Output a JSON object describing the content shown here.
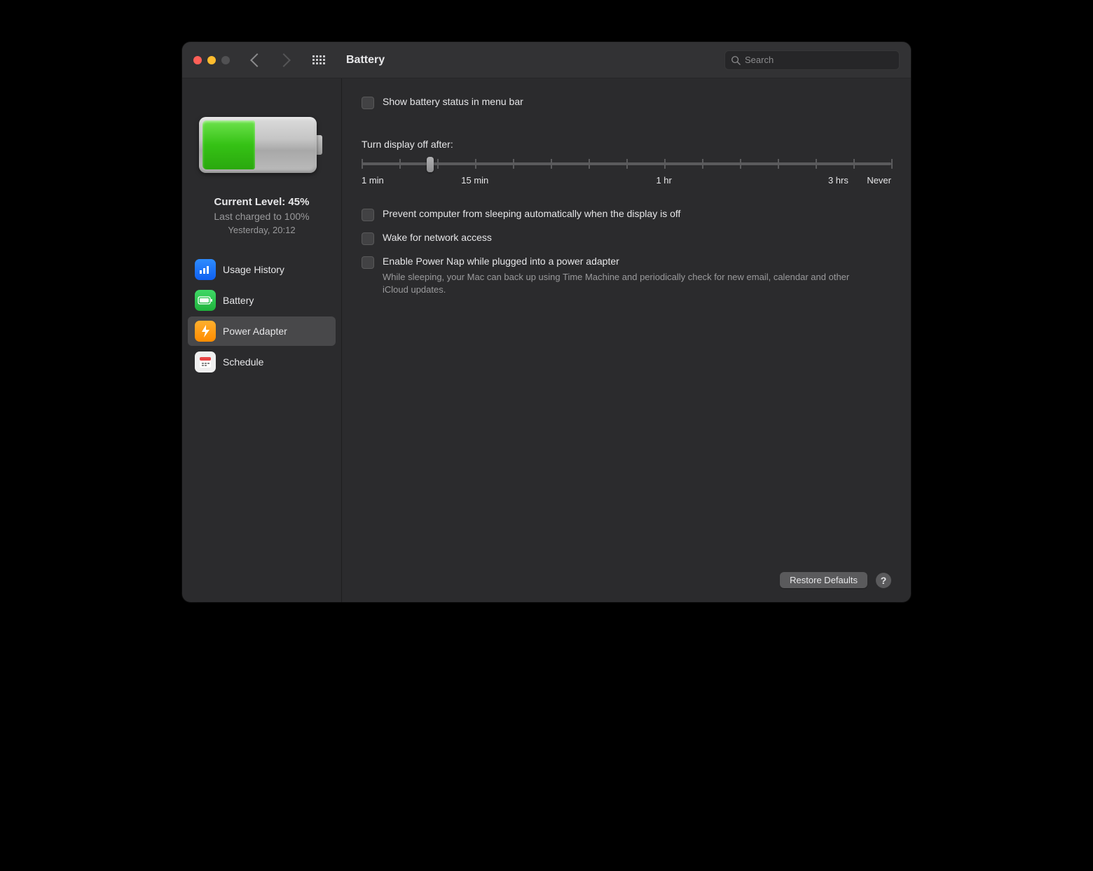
{
  "header": {
    "title": "Battery",
    "search_placeholder": "Search"
  },
  "sidebar": {
    "level": {
      "current": "Current Level: 45%",
      "charged": "Last charged to 100%",
      "when": "Yesterday, 20:12",
      "percent": 45
    },
    "items": [
      {
        "label": "Usage History"
      },
      {
        "label": "Battery"
      },
      {
        "label": "Power Adapter"
      },
      {
        "label": "Schedule"
      }
    ],
    "selected_index": 2
  },
  "main": {
    "show_menu_bar": "Show battery status in menu bar",
    "slider": {
      "title": "Turn display off after:",
      "labels": [
        "1 min",
        "15 min",
        "1 hr",
        "3 hrs",
        "Never"
      ],
      "thumb_percent": 13
    },
    "checks": [
      {
        "label": "Prevent computer from sleeping automatically when the display is off"
      },
      {
        "label": "Wake for network access"
      },
      {
        "label": "Enable Power Nap while plugged into a power adapter",
        "desc": "While sleeping, your Mac can back up using Time Machine and periodically check for new email, calendar and other iCloud updates."
      }
    ]
  },
  "footer": {
    "restore": "Restore Defaults",
    "help": "?"
  }
}
